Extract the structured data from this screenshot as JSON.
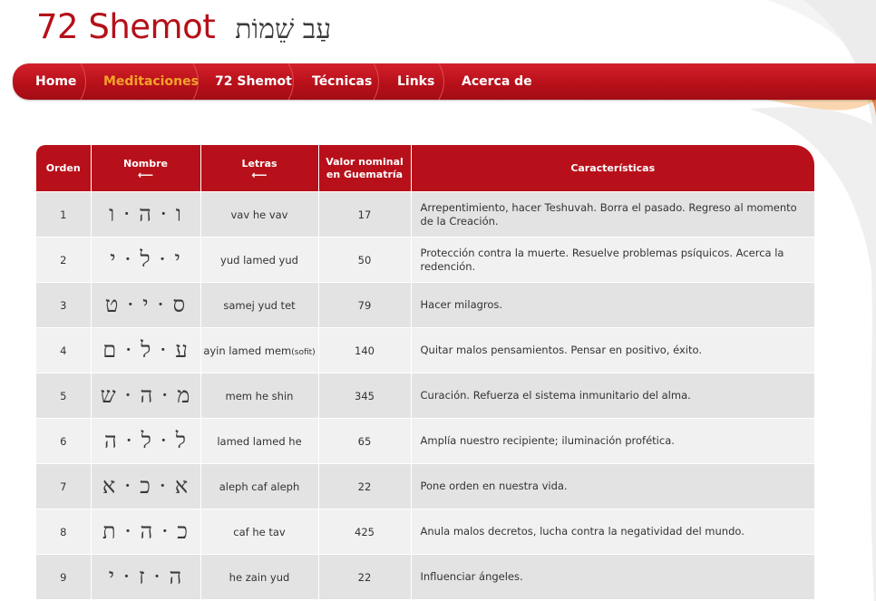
{
  "site": {
    "title": "72 Shemot",
    "title_hebrew": "עַב שֵׁמוֹת"
  },
  "nav": {
    "items": [
      {
        "label": "Home",
        "active": false
      },
      {
        "label": "Meditaciones",
        "active": true
      },
      {
        "label": "72 Shemot",
        "active": false
      },
      {
        "label": "Técnicas",
        "active": false
      },
      {
        "label": "Links",
        "active": false
      },
      {
        "label": "Acerca de",
        "active": false
      }
    ]
  },
  "table": {
    "headers": {
      "orden": "Orden",
      "nombre": "Nombre",
      "nombre_arrow": "⟵",
      "letras": "Letras",
      "letras_arrow": "⟵",
      "valor_line1": "Valor nominal",
      "valor_line2": "en Guematría",
      "caracteristicas": "Características"
    },
    "rows": [
      {
        "orden": "1",
        "nombre": "ו · ה · ו",
        "letras": "vav he vav",
        "letras_extra": "",
        "valor": "17",
        "caracteristicas": "Arrepentimiento, hacer Teshuvah. Borra el pasado. Regreso al momento de la Creación."
      },
      {
        "orden": "2",
        "nombre": "י · ל · י",
        "letras": "yud lamed yud",
        "letras_extra": "",
        "valor": "50",
        "caracteristicas": "Protección contra la muerte. Resuelve problemas psíquicos. Acerca la redención."
      },
      {
        "orden": "3",
        "nombre": "ס · י · ט",
        "letras": "samej yud tet",
        "letras_extra": "",
        "valor": "79",
        "caracteristicas": "Hacer milagros."
      },
      {
        "orden": "4",
        "nombre": "ע · ל · ם",
        "letras": "ayin lamed mem",
        "letras_extra": "(sofit)",
        "valor": "140",
        "caracteristicas": "Quitar malos pensamientos. Pensar en positivo, éxito."
      },
      {
        "orden": "5",
        "nombre": "מ · ה · ש",
        "letras": "mem he shin",
        "letras_extra": "",
        "valor": "345",
        "caracteristicas": "Curación. Refuerza el sistema inmunitario del alma."
      },
      {
        "orden": "6",
        "nombre": "ל · ל · ה",
        "letras": "lamed lamed he",
        "letras_extra": "",
        "valor": "65",
        "caracteristicas": "Amplía nuestro recipiente; iluminación profética."
      },
      {
        "orden": "7",
        "nombre": "א · כ · א",
        "letras": "aleph caf aleph",
        "letras_extra": "",
        "valor": "22",
        "caracteristicas": "Pone orden en nuestra vida."
      },
      {
        "orden": "8",
        "nombre": "כ · ה · ת",
        "letras": "caf he tav",
        "letras_extra": "",
        "valor": "425",
        "caracteristicas": "Anula malos decretos, lucha contra la negatividad del mundo."
      },
      {
        "orden": "9",
        "nombre": "ה · ז · י",
        "letras": "he zain yud",
        "letras_extra": "",
        "valor": "22",
        "caracteristicas": "Influenciar ángeles."
      }
    ]
  },
  "colors": {
    "brand_red": "#b8101a",
    "active_nav": "#f3a22a"
  }
}
